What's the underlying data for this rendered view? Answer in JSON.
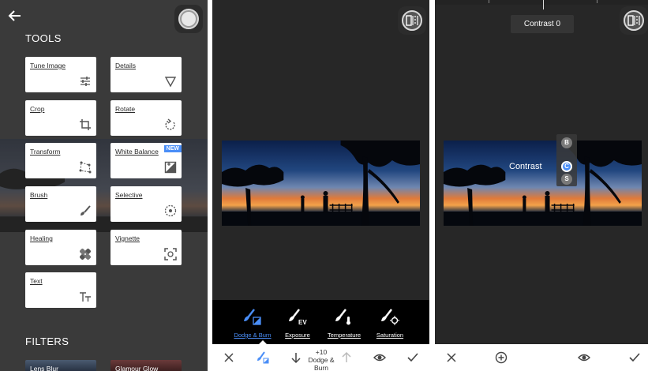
{
  "colors": {
    "accent": "#4a8ef7",
    "panel_dark": "#272727",
    "tools_bg": "#3a3a3a",
    "card_bg": "#ffffff"
  },
  "tools_panel": {
    "section_tools": "TOOLS",
    "section_filters": "FILTERS",
    "cards": [
      {
        "label": "Tune Image",
        "icon": "sliders-icon"
      },
      {
        "label": "Details",
        "icon": "triangle-icon"
      },
      {
        "label": "Crop",
        "icon": "crop-icon"
      },
      {
        "label": "Rotate",
        "icon": "rotate-icon"
      },
      {
        "label": "Transform",
        "icon": "transform-icon"
      },
      {
        "label": "White Balance",
        "icon": "white-balance-icon",
        "badge": "NEW"
      },
      {
        "label": "Brush",
        "icon": "brush-icon"
      },
      {
        "label": "Selective",
        "icon": "selective-icon"
      },
      {
        "label": "Healing",
        "icon": "healing-icon"
      },
      {
        "label": "Vignette",
        "icon": "vignette-icon"
      },
      {
        "label": "Text",
        "icon": "text-icon"
      }
    ],
    "filters": [
      "Lens Blur",
      "Glamour Glow"
    ]
  },
  "brush_panel": {
    "tools": [
      {
        "label": "Dodge & Burn",
        "icon": "dodge-burn-icon",
        "active": true
      },
      {
        "label": "Exposure",
        "icon": "exposure-brush-icon",
        "active": false
      },
      {
        "label": "Temperature",
        "icon": "temperature-brush-icon",
        "active": false
      },
      {
        "label": "Saturation",
        "icon": "saturation-brush-icon",
        "active": false
      }
    ],
    "value": "+10",
    "value_tool": "Dodge & Burn"
  },
  "selective_panel": {
    "tooltip": "Contrast 0",
    "overlay_label": "Contrast",
    "markers": [
      "B",
      "C",
      "S"
    ],
    "active_marker": "C"
  }
}
